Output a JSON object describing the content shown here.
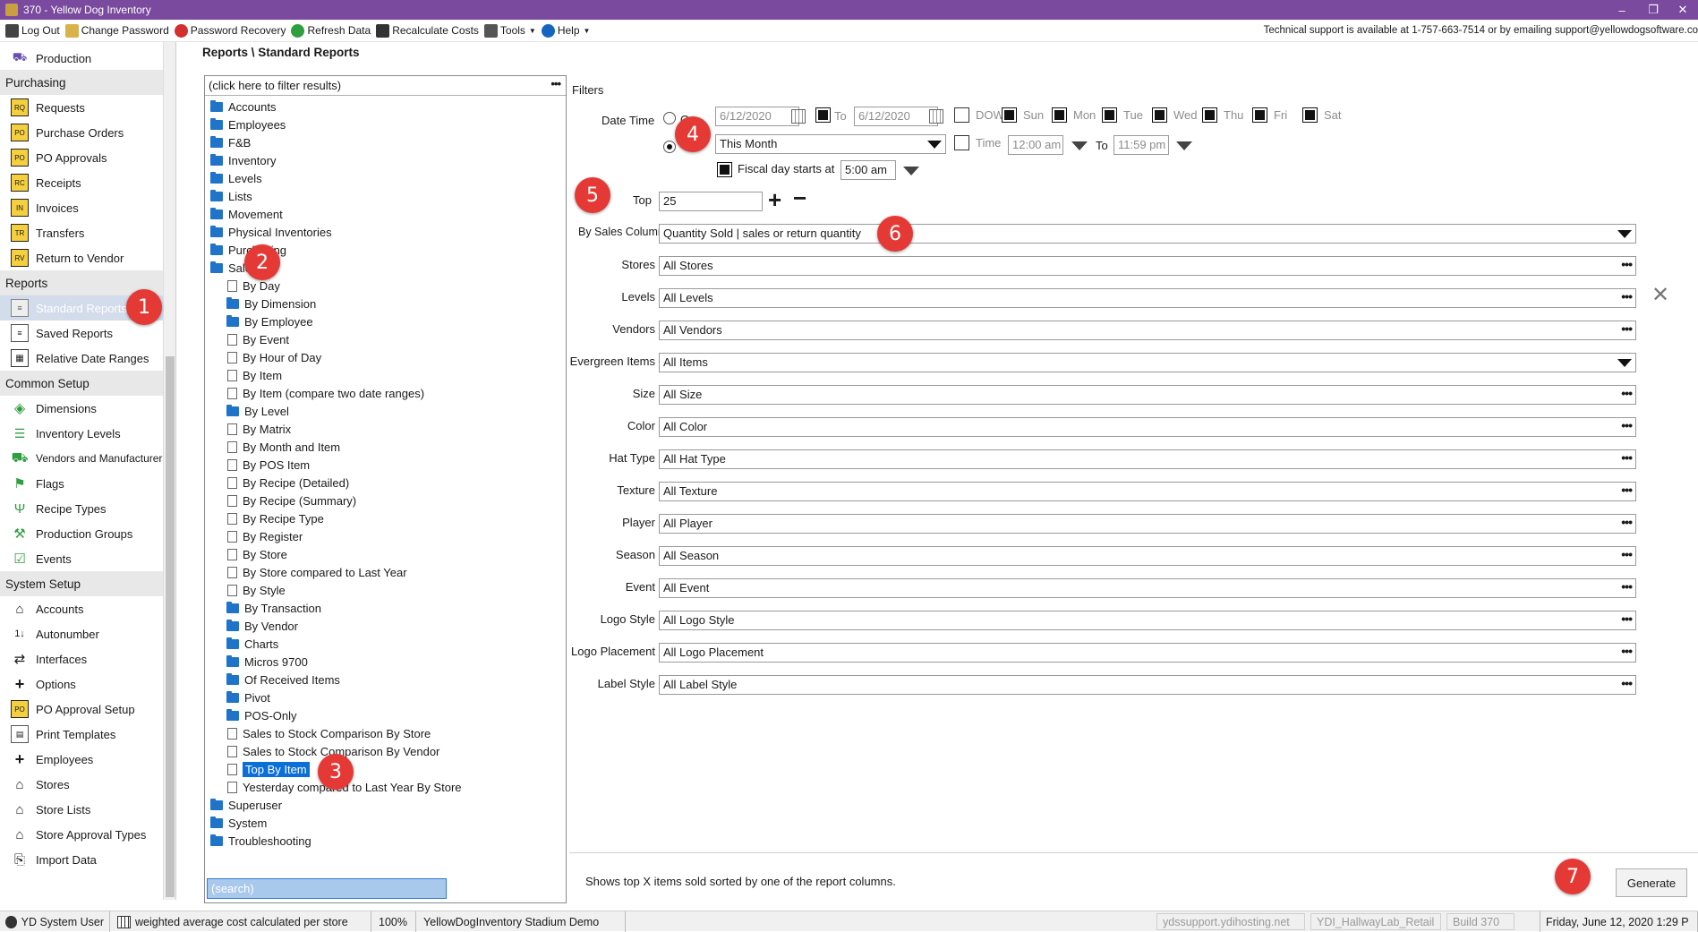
{
  "window": {
    "title": "370 - Yellow Dog Inventory",
    "controls": [
      "–",
      "❐",
      "✕"
    ]
  },
  "menubar": {
    "items": [
      "Log Out",
      "Change Password",
      "Password Recovery",
      "Refresh Data",
      "Recalculate Costs",
      "Tools",
      "Help"
    ],
    "support_text": "Technical support is available at 1-757-663-7514 or by emailing support@yellowdogsoftware.co"
  },
  "sidebar": {
    "production": "Production",
    "purchasing_head": "Purchasing",
    "purchasing": [
      "Requests",
      "Purchase Orders",
      "PO Approvals",
      "Receipts",
      "Invoices",
      "Transfers",
      "Return to Vendor"
    ],
    "reports_head": "Reports",
    "reports": [
      "Standard Reports",
      "Saved Reports",
      "Relative Date Ranges"
    ],
    "common_head": "Common Setup",
    "common": [
      "Dimensions",
      "Inventory Levels",
      "Vendors and Manufacturers",
      "Flags",
      "Recipe Types",
      "Production Groups",
      "Events"
    ],
    "system_head": "System Setup",
    "system": [
      "Accounts",
      "Autonumber",
      "Interfaces",
      "Options",
      "PO Approval Setup",
      "Print Templates",
      "Employees",
      "Stores",
      "Store Lists",
      "Store Approval Types",
      "Import Data"
    ]
  },
  "breadcrumb": "Reports \\ Standard Reports",
  "tree": {
    "filter_placeholder": "(click here to filter results)",
    "top_folders": [
      "Accounts",
      "Employees",
      "F&B",
      "Inventory",
      "Levels",
      "Lists",
      "Movement",
      "Physical Inventories",
      "Purchasing",
      "Sales"
    ],
    "sales_children": [
      {
        "label": "By Day",
        "kind": "doc"
      },
      {
        "label": "By Dimension",
        "kind": "folder"
      },
      {
        "label": "By Employee",
        "kind": "folder"
      },
      {
        "label": "By Event",
        "kind": "doc"
      },
      {
        "label": "By Hour of Day",
        "kind": "doc"
      },
      {
        "label": "By Item",
        "kind": "doc"
      },
      {
        "label": "By Item (compare two date ranges)",
        "kind": "doc"
      },
      {
        "label": "By Level",
        "kind": "folder"
      },
      {
        "label": "By Matrix",
        "kind": "doc"
      },
      {
        "label": "By Month and Item",
        "kind": "doc"
      },
      {
        "label": "By POS Item",
        "kind": "doc"
      },
      {
        "label": "By Recipe (Detailed)",
        "kind": "doc"
      },
      {
        "label": "By Recipe (Summary)",
        "kind": "doc"
      },
      {
        "label": "By Recipe Type",
        "kind": "doc"
      },
      {
        "label": "By Register",
        "kind": "doc"
      },
      {
        "label": "By Store",
        "kind": "doc"
      },
      {
        "label": "By Store compared to Last Year",
        "kind": "doc"
      },
      {
        "label": "By Style",
        "kind": "doc"
      },
      {
        "label": "By Transaction",
        "kind": "folder"
      },
      {
        "label": "By Vendor",
        "kind": "folder"
      },
      {
        "label": "Charts",
        "kind": "folder"
      },
      {
        "label": "Micros 9700",
        "kind": "folder"
      },
      {
        "label": "Of Received Items",
        "kind": "folder"
      },
      {
        "label": "Pivot",
        "kind": "folder"
      },
      {
        "label": "POS-Only",
        "kind": "folder"
      },
      {
        "label": "Sales to Stock Comparison By Store",
        "kind": "doc"
      },
      {
        "label": "Sales to Stock Comparison By Vendor",
        "kind": "doc"
      },
      {
        "label": "Top By Item",
        "kind": "doc"
      },
      {
        "label": "Yesterday compared to Last Year By Store",
        "kind": "doc"
      }
    ],
    "bottom_folders": [
      "Superuser",
      "System",
      "Troubleshooting"
    ],
    "search_text": "(search)"
  },
  "filters": {
    "heading": "Filters",
    "date_time_label": "Date Time",
    "on_label": "On",
    "on_date": "6/12/2020",
    "to_label": "To",
    "to_date": "6/12/2020",
    "dow_label": "DOW",
    "days": [
      "Sun",
      "Mon",
      "Tue",
      "Wed",
      "Thu",
      "Fri",
      "Sat"
    ],
    "range_value": "This Month",
    "time_label": "Time",
    "time_from": "12:00 am",
    "time_to_label": "To",
    "time_to": "11:59 pm",
    "fiscal_label": "Fiscal day starts at",
    "fiscal_time": "5:00 am",
    "top_label": "Top",
    "top_value": "25",
    "by_sales_label": "By Sales Column",
    "by_sales_value": "Quantity Sold | sales or return quantity",
    "rows": [
      {
        "label": "Stores",
        "value": "All Stores",
        "ctl": "dots"
      },
      {
        "label": "Levels",
        "value": "All Levels",
        "ctl": "dots"
      },
      {
        "label": "Vendors",
        "value": "All Vendors",
        "ctl": "dots"
      },
      {
        "label": "Evergreen Items",
        "value": "All Items",
        "ctl": "dd"
      },
      {
        "label": "Size",
        "value": "All Size",
        "ctl": "dots"
      },
      {
        "label": "Color",
        "value": "All Color",
        "ctl": "dots"
      },
      {
        "label": "Hat Type",
        "value": "All Hat Type",
        "ctl": "dots"
      },
      {
        "label": "Texture",
        "value": "All Texture",
        "ctl": "dots"
      },
      {
        "label": "Player",
        "value": "All Player",
        "ctl": "dots"
      },
      {
        "label": "Season",
        "value": "All Season",
        "ctl": "dots"
      },
      {
        "label": "Event",
        "value": "All Event",
        "ctl": "dots"
      },
      {
        "label": "Logo Style",
        "value": "All Logo Style",
        "ctl": "dots"
      },
      {
        "label": "Logo Placement",
        "value": "All Logo Placement",
        "ctl": "dots"
      },
      {
        "label": "Label Style",
        "value": "All Label Style",
        "ctl": "dots"
      }
    ],
    "description": "Shows top X items sold sorted by one of the report columns.",
    "generate_label": "Generate"
  },
  "badges": [
    "1",
    "2",
    "3",
    "4",
    "5",
    "6",
    "7"
  ],
  "statusbar": {
    "user": "YD System User",
    "cost_note": "weighted average cost calculated per store",
    "zoom": "100%",
    "db": "YellowDogInventory Stadium Demo",
    "host": "ydssupport.ydihosting.net",
    "instance": "YDI_HallwayLab_Retail",
    "build": "Build 370",
    "datetime": "Friday, June 12, 2020 1:29 P"
  },
  "colors": {
    "titlebar": "#7a4a9e",
    "selection": "#0b6fd8",
    "folder": "#1f73c9",
    "badge": "#e53935"
  }
}
